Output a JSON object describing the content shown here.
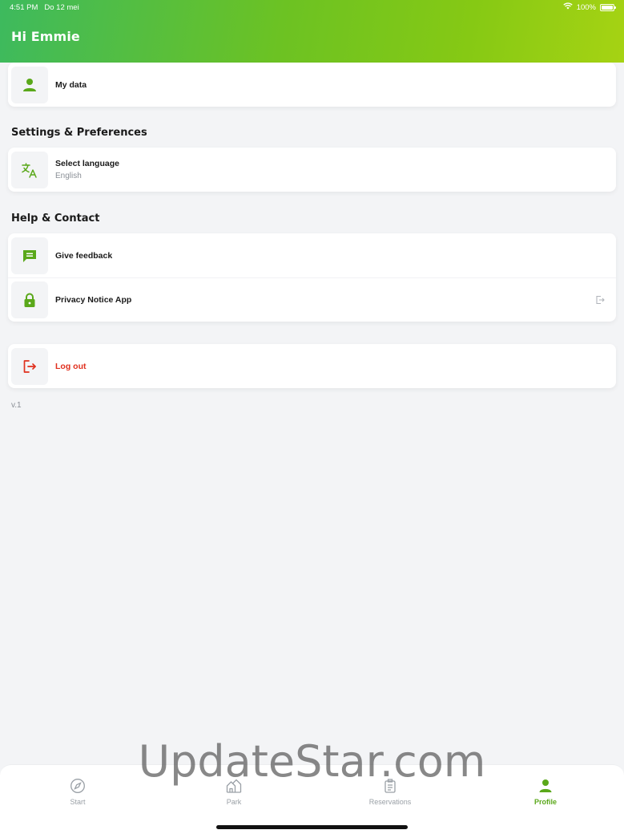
{
  "status_bar": {
    "time": "4:51 PM",
    "date": "Do 12 mei",
    "battery": "100%",
    "icons": [
      "wifi-icon",
      "battery-icon"
    ]
  },
  "header": {
    "greeting": "Hi Emmie"
  },
  "account": {
    "my_data": {
      "label": "My data",
      "icon": "person-icon"
    }
  },
  "settings": {
    "title": "Settings & Preferences",
    "language": {
      "label": "Select language",
      "value": "English",
      "icon": "translate-icon"
    }
  },
  "help": {
    "title": "Help & Contact",
    "items": [
      {
        "label": "Give feedback",
        "icon": "feedback-icon"
      },
      {
        "label": "Privacy Notice App",
        "icon": "lock-icon",
        "trailing_icon": "external-link-icon"
      }
    ]
  },
  "logout": {
    "label": "Log out",
    "icon": "logout-icon"
  },
  "version": "v.1",
  "tabs": [
    {
      "label": "Start",
      "icon": "compass-icon",
      "active": false
    },
    {
      "label": "Park",
      "icon": "park-icon",
      "active": false
    },
    {
      "label": "Reservations",
      "icon": "reservations-icon",
      "active": false
    },
    {
      "label": "Profile",
      "icon": "person-icon",
      "active": true
    }
  ],
  "watermark": "UpdateStar.com",
  "colors": {
    "brand_green": "#5aa81a",
    "header_gradient_start": "#3dba5e",
    "header_gradient_end": "#a6d313",
    "logout_red": "#e0301e",
    "background": "#f3f4f6"
  }
}
